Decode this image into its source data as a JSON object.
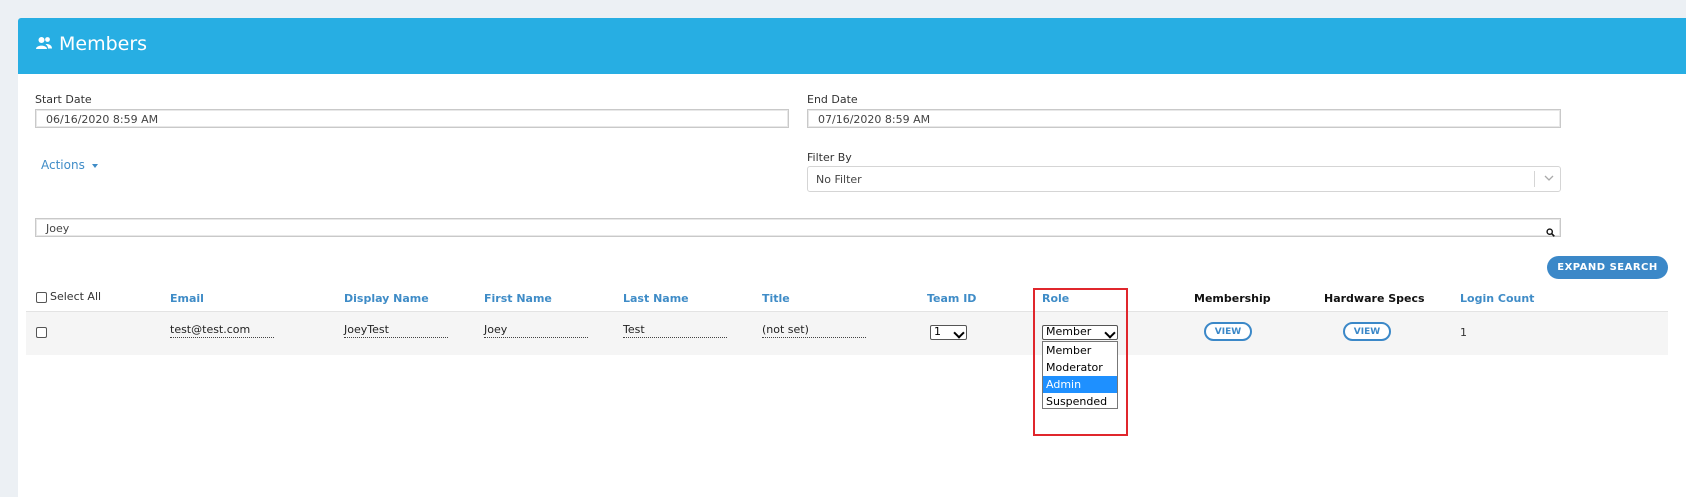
{
  "header": {
    "title": "Members",
    "icon": "users-icon"
  },
  "filters": {
    "start_date_label": "Start Date",
    "start_date_value": "06/16/2020 8:59 AM",
    "end_date_label": "End Date",
    "end_date_value": "07/16/2020 8:59 AM",
    "actions_label": "Actions",
    "filter_by_label": "Filter By",
    "filter_by_value": "No Filter",
    "search_value": "Joey",
    "expand_search_label": "EXPAND SEARCH"
  },
  "table": {
    "select_all_label": "Select All",
    "columns": {
      "email": "Email",
      "display_name": "Display Name",
      "first_name": "First Name",
      "last_name": "Last Name",
      "title": "Title",
      "team_id": "Team ID",
      "role": "Role",
      "membership": "Membership",
      "hardware_specs": "Hardware Specs",
      "login_count": "Login Count"
    },
    "rows": [
      {
        "email": "test@test.com",
        "display_name": "JoeyTest",
        "first_name": "Joey",
        "last_name": "Test",
        "title": "(not set)",
        "team_id": "1",
        "role": "Member",
        "membership_btn": "VIEW",
        "hardware_btn": "VIEW",
        "login_count": "1"
      }
    ]
  },
  "role_dropdown": {
    "options": [
      "Member",
      "Moderator",
      "Admin",
      "Suspended"
    ],
    "highlighted": "Admin"
  },
  "colors": {
    "header_bg": "#27aee3",
    "link_blue": "#3f8cc7",
    "button_blue": "#3b88c8",
    "highlight_red": "#e0262c",
    "option_selected": "#1e90ff"
  }
}
